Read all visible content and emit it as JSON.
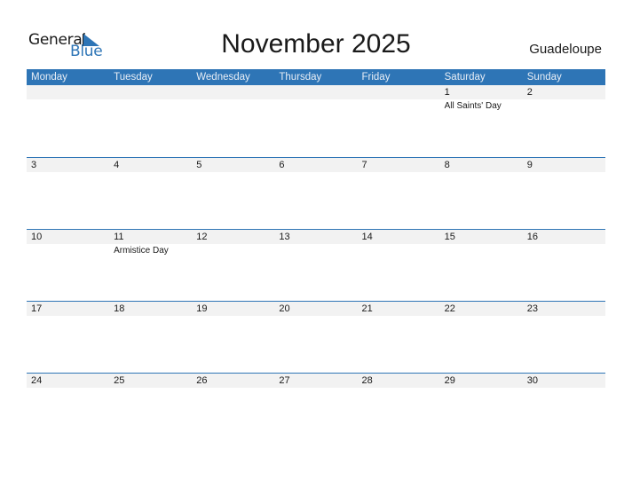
{
  "brand": {
    "line1": "General",
    "line2": "Blue",
    "accent": "#2e75b6"
  },
  "title": "November 2025",
  "region": "Guadeloupe",
  "weekdays": [
    "Monday",
    "Tuesday",
    "Wednesday",
    "Thursday",
    "Friday",
    "Saturday",
    "Sunday"
  ],
  "weeks": [
    [
      {
        "day": "",
        "holiday": ""
      },
      {
        "day": "",
        "holiday": ""
      },
      {
        "day": "",
        "holiday": ""
      },
      {
        "day": "",
        "holiday": ""
      },
      {
        "day": "",
        "holiday": ""
      },
      {
        "day": "1",
        "holiday": "All Saints' Day"
      },
      {
        "day": "2",
        "holiday": ""
      }
    ],
    [
      {
        "day": "3",
        "holiday": ""
      },
      {
        "day": "4",
        "holiday": ""
      },
      {
        "day": "5",
        "holiday": ""
      },
      {
        "day": "6",
        "holiday": ""
      },
      {
        "day": "7",
        "holiday": ""
      },
      {
        "day": "8",
        "holiday": ""
      },
      {
        "day": "9",
        "holiday": ""
      }
    ],
    [
      {
        "day": "10",
        "holiday": ""
      },
      {
        "day": "11",
        "holiday": "Armistice Day"
      },
      {
        "day": "12",
        "holiday": ""
      },
      {
        "day": "13",
        "holiday": ""
      },
      {
        "day": "14",
        "holiday": ""
      },
      {
        "day": "15",
        "holiday": ""
      },
      {
        "day": "16",
        "holiday": ""
      }
    ],
    [
      {
        "day": "17",
        "holiday": ""
      },
      {
        "day": "18",
        "holiday": ""
      },
      {
        "day": "19",
        "holiday": ""
      },
      {
        "day": "20",
        "holiday": ""
      },
      {
        "day": "21",
        "holiday": ""
      },
      {
        "day": "22",
        "holiday": ""
      },
      {
        "day": "23",
        "holiday": ""
      }
    ],
    [
      {
        "day": "24",
        "holiday": ""
      },
      {
        "day": "25",
        "holiday": ""
      },
      {
        "day": "26",
        "holiday": ""
      },
      {
        "day": "27",
        "holiday": ""
      },
      {
        "day": "28",
        "holiday": ""
      },
      {
        "day": "29",
        "holiday": ""
      },
      {
        "day": "30",
        "holiday": ""
      }
    ]
  ]
}
